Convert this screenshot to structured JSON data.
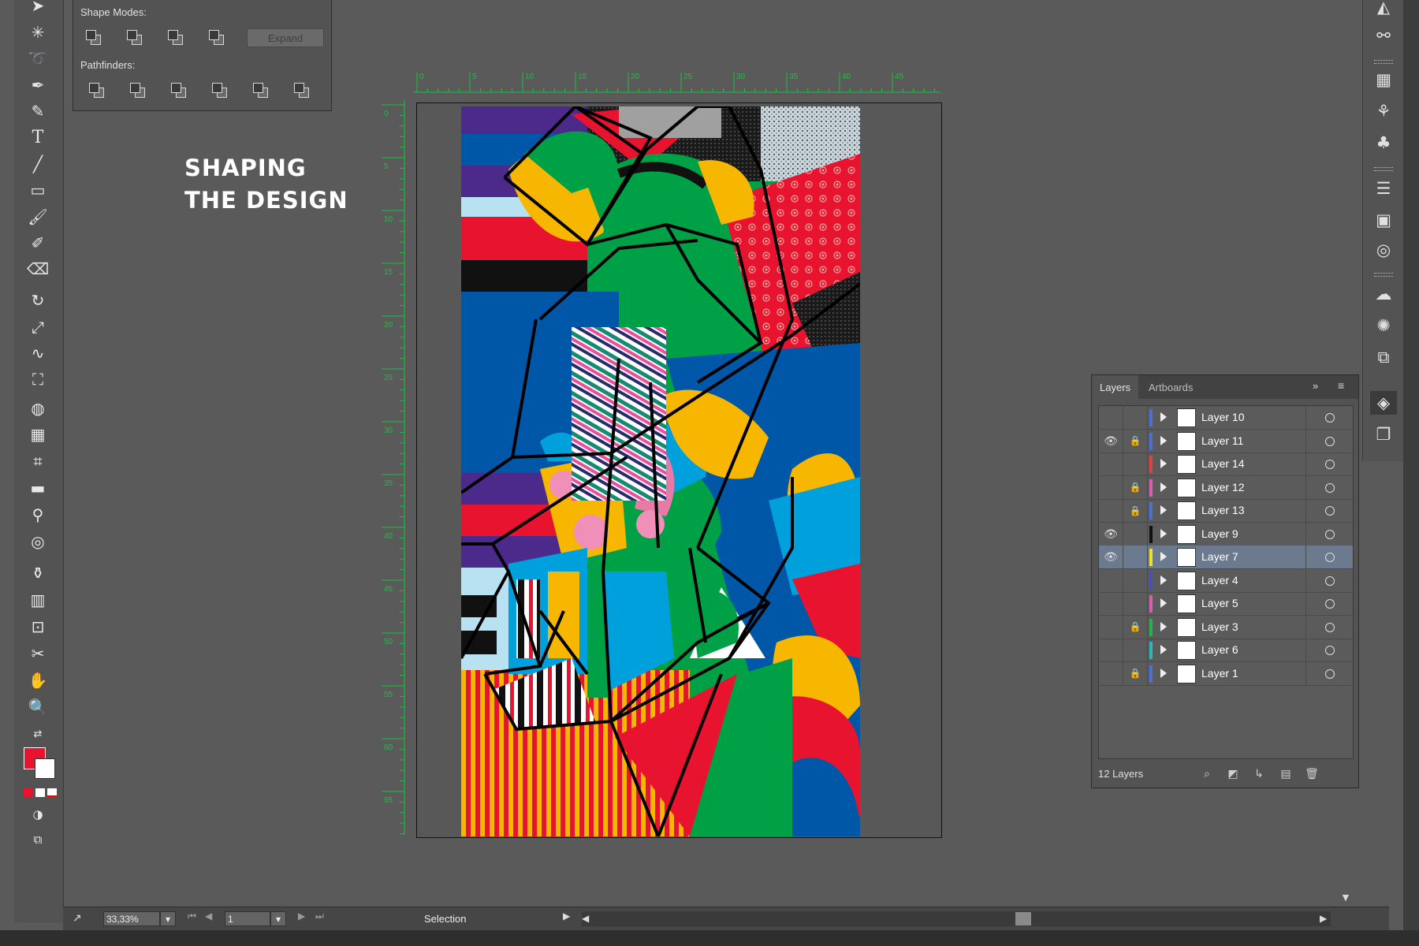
{
  "title_lines": [
    "SHAPING",
    "THE DESIGN"
  ],
  "pathfinder": {
    "shape_modes_label": "Shape Modes:",
    "pathfinders_label": "Pathfinders:",
    "expand_label": "Expand"
  },
  "ruler": {
    "horizontal_ticks": [
      "0",
      "5",
      "10",
      "15",
      "20",
      "25",
      "30",
      "35",
      "40",
      "45"
    ],
    "vertical_ticks": [
      "0",
      "5",
      "10",
      "15",
      "20",
      "25",
      "30",
      "35",
      "40",
      "45",
      "50",
      "55",
      "60",
      "65"
    ]
  },
  "layers_panel": {
    "tabs": [
      "Layers",
      "Artboards"
    ],
    "layers": [
      {
        "name": "Layer 10",
        "visible": false,
        "locked": false,
        "color": "#4b6fd6"
      },
      {
        "name": "Layer 11",
        "visible": true,
        "locked": true,
        "color": "#4b6fd6"
      },
      {
        "name": "Layer 14",
        "visible": false,
        "locked": false,
        "color": "#e0423c"
      },
      {
        "name": "Layer 12",
        "visible": false,
        "locked": true,
        "color": "#d65fb2"
      },
      {
        "name": "Layer 13",
        "visible": false,
        "locked": true,
        "color": "#4b6fd6"
      },
      {
        "name": "Layer 9",
        "visible": true,
        "locked": false,
        "color": "#111111"
      },
      {
        "name": "Layer 7",
        "visible": true,
        "locked": false,
        "color": "#f2e01b",
        "selected": true
      },
      {
        "name": "Layer 4",
        "visible": false,
        "locked": false,
        "color": "#4b4fb8"
      },
      {
        "name": "Layer 5",
        "visible": false,
        "locked": false,
        "color": "#d65fb2"
      },
      {
        "name": "Layer 3",
        "visible": false,
        "locked": true,
        "color": "#26b34a"
      },
      {
        "name": "Layer 6",
        "visible": false,
        "locked": false,
        "color": "#2bb6c0"
      },
      {
        "name": "Layer 1",
        "visible": false,
        "locked": true,
        "color": "#4b6fd6"
      }
    ],
    "count_label": "12 Layers"
  },
  "statusbar": {
    "zoom": "33,33%",
    "page": "1",
    "tool": "Selection"
  },
  "icons": {
    "toolbar": [
      "selection-icon",
      "magic-wand-icon",
      "lasso-icon",
      "pen-icon",
      "curvature-icon",
      "type-icon",
      "line-icon",
      "rectangle-icon",
      "paintbrush-icon",
      "blob-brush-icon",
      "eraser-icon",
      "rotate-icon",
      "scale-icon",
      "warp-icon",
      "free-transform-icon",
      "shape-builder-icon",
      "perspective-grid-icon",
      "mesh-icon",
      "gradient-icon",
      "eyedropper-icon",
      "blend-icon",
      "symbol-sprayer-icon",
      "graph-icon",
      "artboard-icon",
      "slice-icon",
      "hand-icon",
      "zoom-icon"
    ],
    "dock": [
      "image-trace-icon",
      "links-icon",
      "swatches-icon",
      "brushes-icon",
      "symbols-icon",
      "stroke-icon",
      "gradient-panel-icon",
      "transparency-icon",
      "cc-libraries-icon",
      "appearance-icon",
      "export-icon",
      "layers-panel-icon",
      "artboards-panel-icon"
    ]
  },
  "colors": {
    "fill": "#e8132f",
    "workspace": "#5a5a5a",
    "selected_layer": "#6b7a8e"
  }
}
